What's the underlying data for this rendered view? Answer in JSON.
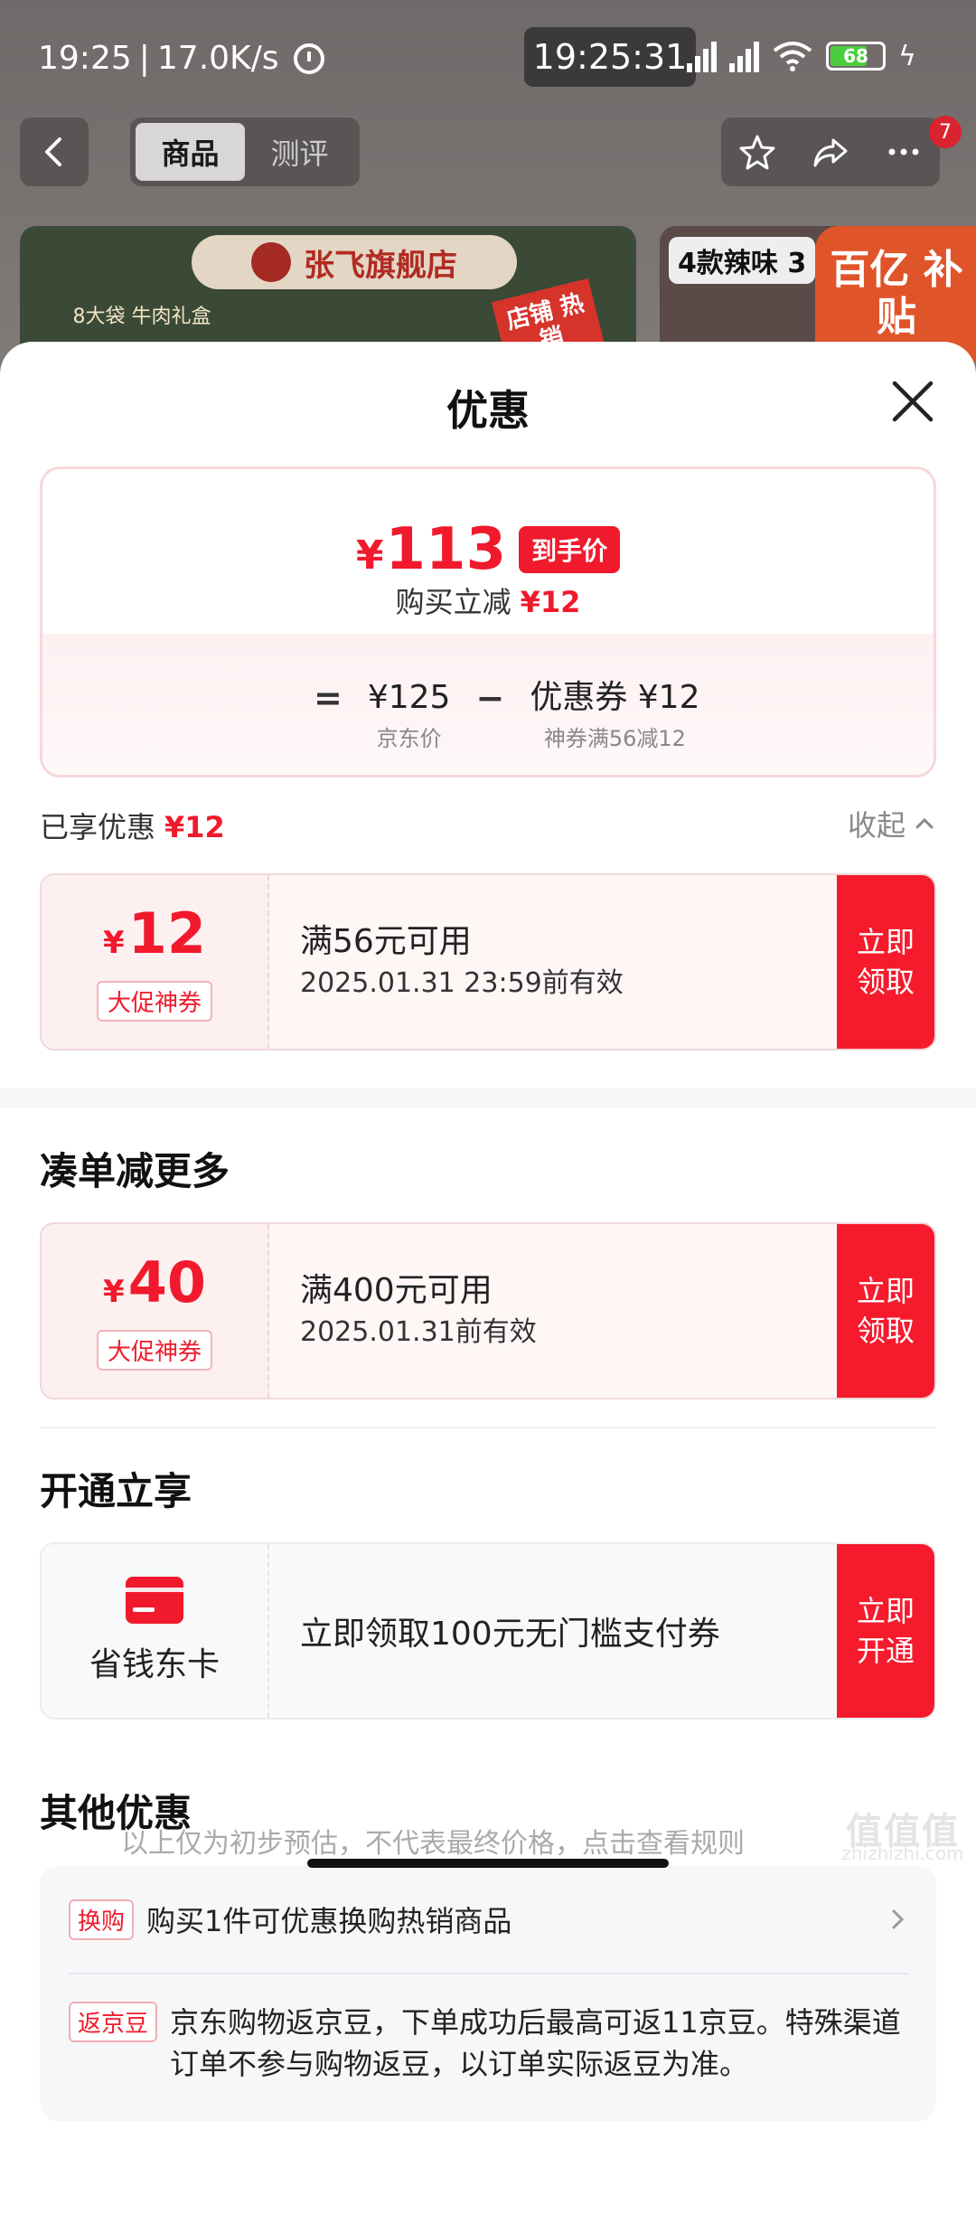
{
  "status_bar": {
    "time": "19:25",
    "net_speed": "17.0K/s",
    "clock": "19:25:31",
    "battery": "68"
  },
  "bg": {
    "tabs": [
      "商品",
      "测评"
    ],
    "badge": "7",
    "store_name": "张飞旗舰店",
    "banner_left_text": "8大袋 牛肉礼盒",
    "banner_hot": "店铺 热销",
    "banner_right_title": "4款辣味 3",
    "subsidy": "百亿 补贴"
  },
  "sheet": {
    "title": "优惠",
    "price": {
      "yen": "¥",
      "final": "113",
      "final_tag": "到手价",
      "sub_label": "购买立减",
      "sub_value": "¥12",
      "eq": "=",
      "minus": "−",
      "jd_value": "¥125",
      "jd_label": "京东价",
      "coupon_value": "优惠券 ¥12",
      "coupon_label": "神券满56减12"
    },
    "enjoyed_label": "已享优惠",
    "enjoyed_value": "¥12",
    "collapse_label": "收起",
    "coupon1": {
      "yen": "¥",
      "amount": "12",
      "tag": "大促神券",
      "condition": "满56元可用",
      "expiry": "2025.01.31 23:59前有效",
      "action": "立即领取"
    },
    "section2_title": "凑单减更多",
    "coupon2": {
      "yen": "¥",
      "amount": "40",
      "tag": "大促神券",
      "condition": "满400元可用",
      "expiry": "2025.01.31前有效",
      "action": "立即领取"
    },
    "section3_title": "开通立享",
    "membership": {
      "label": "省钱东卡",
      "desc": "立即领取100元无门槛支付券",
      "action": "立即开通"
    },
    "section4_title": "其他优惠",
    "other": [
      {
        "tag": "换购",
        "text": "购买1件可优惠换购热销商品"
      },
      {
        "tag": "返京豆",
        "text": "京东购物返京豆，下单成功后最高可返11京豆。特殊渠道订单不参与购物返豆，以订单实际返豆为准。"
      }
    ],
    "footnote": "以上仅为初步预估，不代表最终价格，点击查看规则"
  },
  "watermark": {
    "big": "值值值",
    "small": "zhizhizhi.com"
  },
  "colors": {
    "accent": "#f01a2c",
    "action_bg": "#f51b2d"
  }
}
